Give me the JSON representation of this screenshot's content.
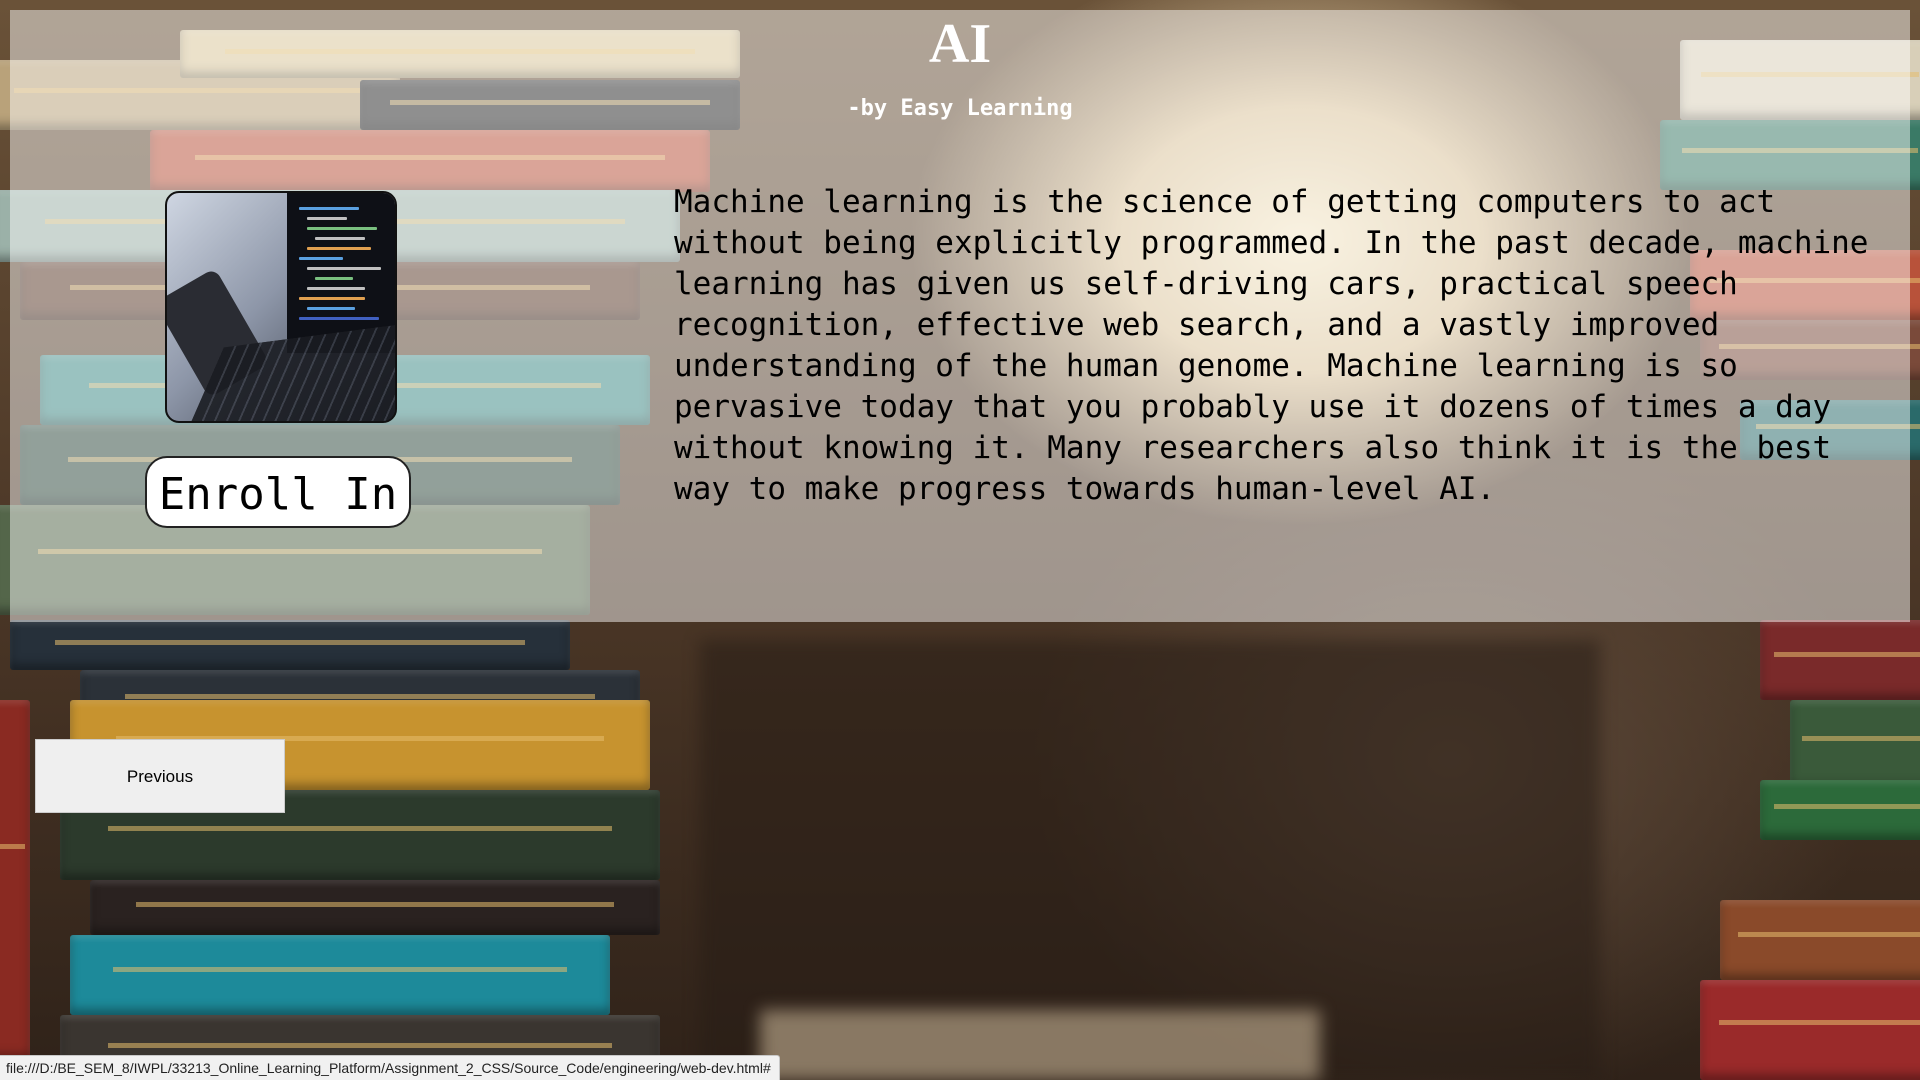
{
  "course": {
    "title": "AI",
    "byline": "-by Easy Learning",
    "description": "Machine learning is the science of getting computers to act without being explicitly programmed. In the past decade, machine learning has given us self-driving cars, practical speech recognition, effective web search, and a vastly improved understanding of the human genome. Machine learning is so pervasive today that you probably use it dozens of times a day without knowing it. Many researchers also think it is the best way to make progress towards human-level AI.",
    "enroll_label": "Enroll In",
    "thumbnail_icon": "laptop-code-image"
  },
  "navigation": {
    "previous_label": "Previous"
  },
  "status_bar": {
    "url": "file:///D:/BE_SEM_8/IWPL/33213_Online_Learning_Platform/Assignment_2_CSS/Source_Code/engineering/web-dev.html#"
  },
  "colors": {
    "panel_overlay": "rgba(255,255,255,0.48)",
    "title_text": "#ffffff",
    "body_text": "#000000",
    "button_bg": "#ffffff",
    "previous_bg": "#efefef"
  }
}
